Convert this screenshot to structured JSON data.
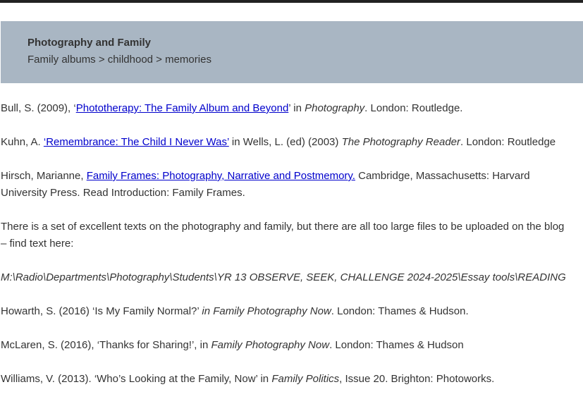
{
  "header": {
    "title": "Photography and Family",
    "breadcrumbs": "Family albums > childhood > memories"
  },
  "refs": [
    {
      "pre": "Bull, S. (2009), ‘",
      "link": "Phototherapy: The Family Album and Beyond",
      "mid": "’ in ",
      "italic": "Photography",
      "post": ". London: Routledge."
    },
    {
      "pre": "Kuhn, A. ",
      "link": "‘Remembrance: The Child I Never Was’",
      "mid": " in Wells, L. (ed) (2003) ",
      "italic": "The Photography Reader",
      "post": ". London: Routledge"
    },
    {
      "pre": "Hirsch, Marianne, ",
      "link": "Family Frames: Photography, Narrative and Postmemory.",
      "post": " Cambridge, Massachusetts: Harvard University Press. Read Introduction: Family Frames."
    }
  ],
  "note": "There is a set of excellent texts on the photography and family, but there are all too large files to be uploaded on the blog – find text here:",
  "path": "M:\\Radio\\Departments\\Photography\\Students\\YR 13 OBSERVE, SEEK, CHALLENGE 2024-2025\\Essay tools\\READING",
  "more_refs": [
    {
      "pre": "Howarth, S. (2016) ‘Is My Family Normal?’ ",
      "italic": "in Family Photography Now",
      "post": ". London: Thames & Hudson."
    },
    {
      "pre": "McLaren, S. (2016), ‘Thanks for Sharing!’, in ",
      "italic": "Family Photography Now",
      "post": ". London: Thames & Hudson"
    },
    {
      "pre": "Williams, V. (2013). ‘Who’s Looking at the Family, Now’ in ",
      "italic": "Family Politics",
      "post": ", Issue 20. Brighton: Photoworks."
    }
  ]
}
